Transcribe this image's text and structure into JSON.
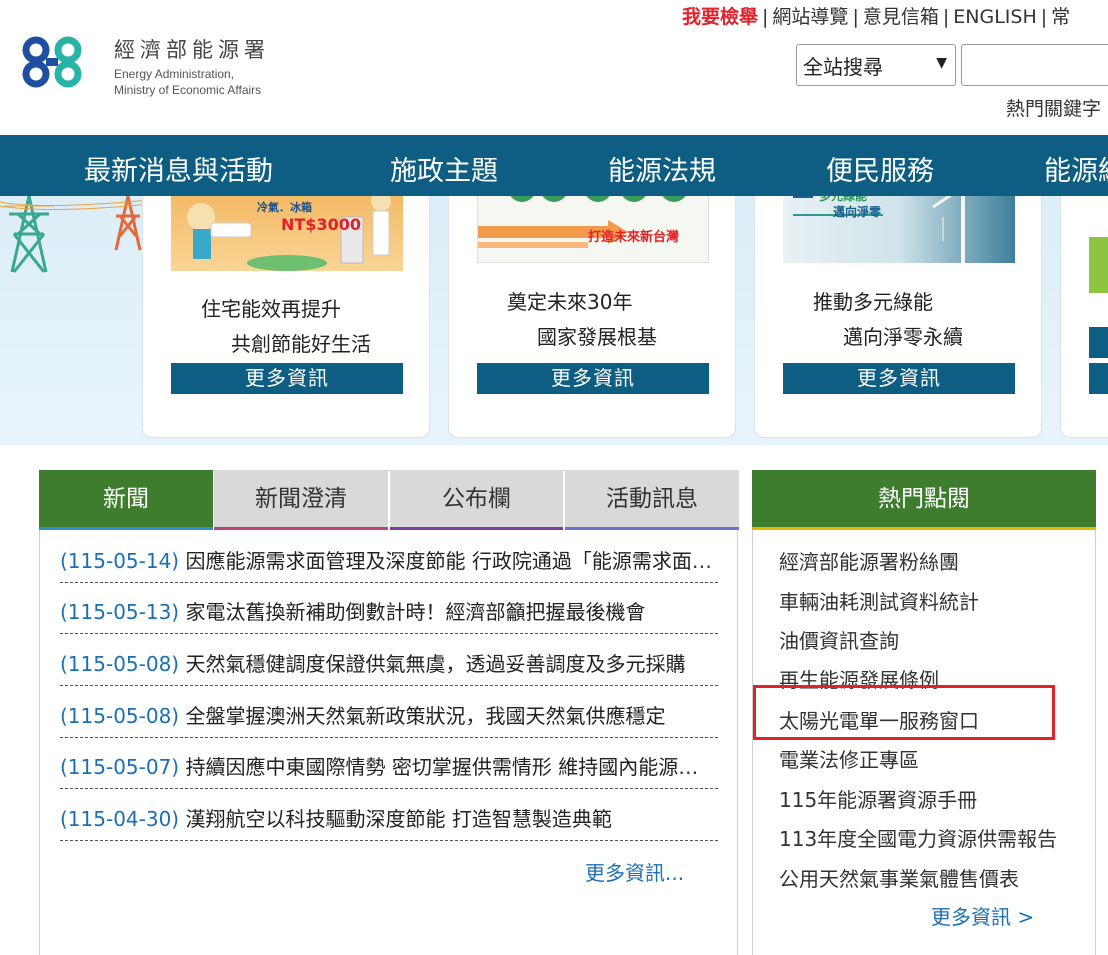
{
  "header": {
    "org_name_zh": "經濟部能源署",
    "org_name_en_1": "Energy Administration,",
    "org_name_en_2": "Ministry of Economic Affairs",
    "top_links": {
      "report": "我要檢舉",
      "sitemap": "網站導覽",
      "feedback": "意見信箱",
      "english": "ENGLISH",
      "extra": "常"
    },
    "search": {
      "scope_selected": "全站搜尋",
      "input_value": ""
    },
    "hot_keywords_label": "熱門關鍵字"
  },
  "nav": {
    "items": [
      "最新消息與活動",
      "施政主題",
      "能源法規",
      "便民服務",
      "能源統"
    ]
  },
  "banner": {
    "cards": [
      {
        "image_caption": "冷氣．冰箱",
        "image_amount": "NT$3000",
        "line1": "住宅能效再提升",
        "line2": "共創節能好生活",
        "button": "更多資訊"
      },
      {
        "image_caption": "打造未來新台灣",
        "line1": "奠定未來30年",
        "line2": "國家發展根基",
        "button": "更多資訊"
      },
      {
        "image_caption": "多元綠能",
        "image_caption2": "邁向淨零",
        "line1": "推動多元綠能",
        "line2": "邁向淨零永續",
        "button": "更多資訊"
      }
    ]
  },
  "news": {
    "tabs": [
      {
        "label": "新聞",
        "active": true,
        "bar_color": "#2f8fc9"
      },
      {
        "label": "新聞澄清",
        "active": false,
        "bar_color": "#c0407a"
      },
      {
        "label": "公布欄",
        "active": false,
        "bar_color": "#7a3fa5"
      },
      {
        "label": "活動訊息",
        "active": false,
        "bar_color": "#6f6fd8"
      }
    ],
    "items": [
      {
        "date": "(115-05-14)",
        "title": "因應能源需求面管理及深度節能 行政院通過「能源需求面管理及深度節能推動方案」"
      },
      {
        "date": "(115-05-13)",
        "title": "家電汰舊換新補助倒數計時！經濟部籲把握最後機會"
      },
      {
        "date": "(115-05-08)",
        "title": "天然氣穩健調度保證供氣無虞，透過妥善調度及多元採購"
      },
      {
        "date": "(115-05-08)",
        "title": "全盤掌握澳洲天然氣新政策狀況，我國天然氣供應穩定"
      },
      {
        "date": "(115-05-07)",
        "title": "持續因應中東國際情勢 密切掌握供需情形 維持國內能源穩定"
      },
      {
        "date": "(115-04-30)",
        "title": "漢翔航空以科技驅動深度節能 打造智慧製造典範"
      }
    ],
    "more": "更多資訊..."
  },
  "hot": {
    "title": "熱門點閱",
    "items": [
      "經濟部能源署粉絲團",
      "車輛油耗測試資料統計",
      "油價資訊查詢",
      "再生能源發展條例",
      "太陽光電單一服務窗口",
      "電業法修正專區",
      "115年能源署資源手冊",
      "113年度全國電力資源供需報告",
      "公用天然氣事業氣體售價表"
    ],
    "more": "更多資訊 >"
  },
  "colors": {
    "nav_bg": "#0d5e82",
    "tab_active": "#3e7d2e",
    "link_blue": "#1a6fb5",
    "highlight_red": "#e0232a"
  }
}
